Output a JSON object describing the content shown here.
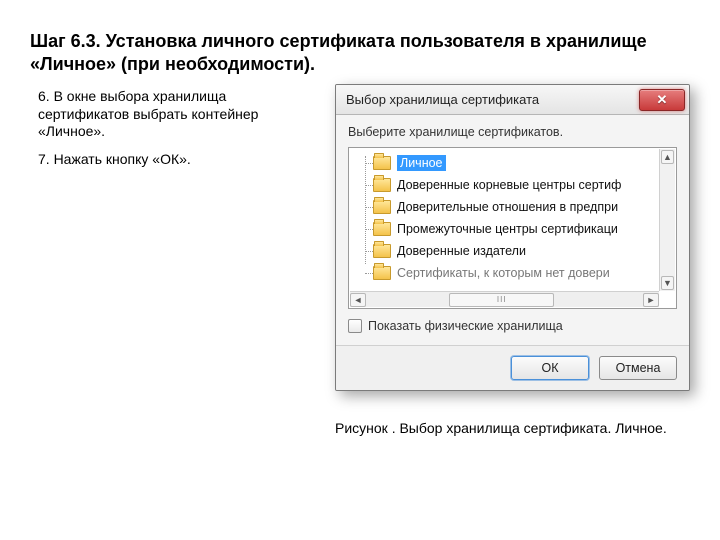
{
  "heading": "Шаг 6.3. Установка личного сертификата пользователя в хранилище «Личное» (при необходимости).",
  "instructions": {
    "step6": "6. В окне выбора хранилища сертификатов выбрать контейнер «Личное».",
    "step7": "7. Нажать кнопку «ОК»."
  },
  "dialog": {
    "title": "Выбор хранилища сертификата",
    "prompt": "Выберите хранилище сертификатов.",
    "items": [
      "Личное",
      "Доверенные корневые центры сертиф",
      "Доверительные отношения в предпри",
      "Промежуточные центры сертификаци",
      "Доверенные издатели",
      "Сертификаты, к которым нет довери"
    ],
    "selected_index": 0,
    "show_physical_label": "Показать физические хранилища",
    "ok_label": "ОК",
    "cancel_label": "Отмена",
    "scroll_grip_label": "III"
  },
  "caption": "Рисунок . Выбор хранилища сертификата. Личное."
}
